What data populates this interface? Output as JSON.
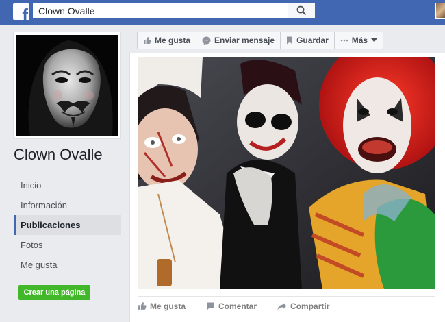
{
  "topbar": {
    "logo_letter": "f",
    "search_value": "Clown Ovalle",
    "search_placeholder": "Buscar"
  },
  "page": {
    "name": "Clown Ovalle"
  },
  "nav": {
    "items": [
      {
        "label": "Inicio"
      },
      {
        "label": "Información"
      },
      {
        "label": "Publicaciones"
      },
      {
        "label": "Fotos"
      },
      {
        "label": "Me gusta"
      }
    ],
    "active_index": 2
  },
  "create_page_label": "Crear una página",
  "actions": {
    "like": "Me gusta",
    "message": "Enviar mensaje",
    "save": "Guardar",
    "more": "Más"
  },
  "post_actions": {
    "like": "Me gusta",
    "comment": "Comentar",
    "share": "Compartir"
  },
  "colors": {
    "brand": "#4267b2",
    "create_button": "#42b72a"
  }
}
